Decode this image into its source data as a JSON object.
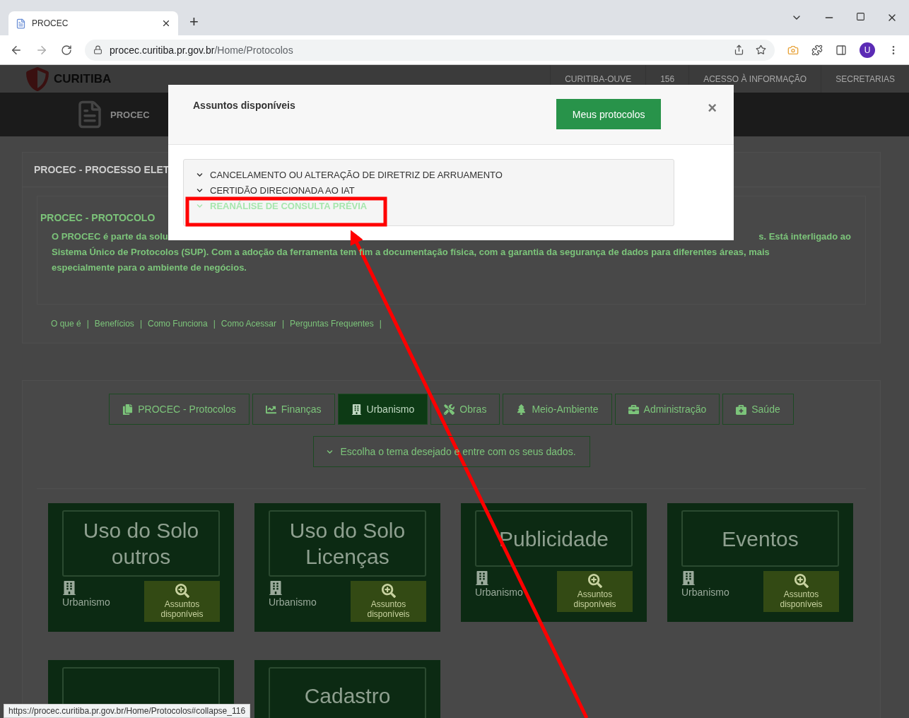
{
  "browser": {
    "tabs": [
      {
        "title": "PROCEC",
        "selected": true
      }
    ],
    "new_tab": "+",
    "url_host": "procec.curitiba.pr.gov.br",
    "url_path": "/Home/Protocolos",
    "profile": "U"
  },
  "site_header": {
    "brand": "CURITIBA",
    "links": [
      "CURITIBA-OUVE",
      "156",
      "ACESSO À INFORMAÇÃO",
      "SECRETARIAS"
    ],
    "logo_text": "PROCEC"
  },
  "intro_panel": {
    "title": "PROCEC - PROCESSO ELET",
    "heading": "PROCEC - PROTOCOLO",
    "text_left": "O PROCEC é parte da solu",
    "text_right": "s. Está interligado ao",
    "lines": [
      "Sistema Único de Protocolos (SUP). Com a adoção da ferramenta tem fim a documentação física, com a garantia da segurança de dados para diferentes áreas, mais",
      "especialmente para o ambiente de negócios."
    ],
    "links": [
      "O que é",
      "Benefícios",
      "Como Funciona",
      "Como Acessar",
      "Perguntas Frequentes"
    ],
    "separator": "|"
  },
  "category_tabs": [
    {
      "label": "PROCEC - Protocolos",
      "kind": "files",
      "selected": false
    },
    {
      "label": "Finanças",
      "kind": "chart",
      "selected": false
    },
    {
      "label": "Urbanismo",
      "kind": "building",
      "selected": true
    },
    {
      "label": "Obras",
      "kind": "tools",
      "selected": false
    },
    {
      "label": "Meio-Ambiente",
      "kind": "tree",
      "selected": false
    },
    {
      "label": "Administração",
      "kind": "briefcase",
      "selected": false
    },
    {
      "label": "Saúde",
      "kind": "medical",
      "selected": false
    }
  ],
  "theme_toggle": "Escolha o tema desejado e entre com os seus dados.",
  "cards": [
    {
      "title": "Uso do Solo outros",
      "category": "Urbanismo",
      "action": "Assuntos disponíveis"
    },
    {
      "title": "Uso do Solo Licenças",
      "category": "Urbanismo",
      "action": "Assuntos disponíveis"
    },
    {
      "title": "Publicidade",
      "category": "Urbanismo",
      "action": "Assuntos disponíveis"
    },
    {
      "title": "Eventos",
      "category": "Urbanismo",
      "action": "Assuntos disponíveis"
    }
  ],
  "cards_row2": [
    {
      "kind": "blank"
    },
    {
      "kind": "titled",
      "title": "Cadastro"
    }
  ],
  "modal": {
    "title": "Assuntos disponíveis",
    "button": "Meus protocolos",
    "close": "×",
    "items": [
      {
        "label": "CANCELAMENTO OU ALTERAÇÃO DE DIRETRIZ DE ARRUAMENTO",
        "hovered": false
      },
      {
        "label": "CERTIDÃO DIRECIONADA AO IAT",
        "hovered": false
      },
      {
        "label": "REANÁLISE DE CONSULTA PRÉVIA",
        "hovered": true
      }
    ]
  },
  "status_url": "https://procec.curitiba.pr.gov.br/Home/Protocolos#collapse_116"
}
